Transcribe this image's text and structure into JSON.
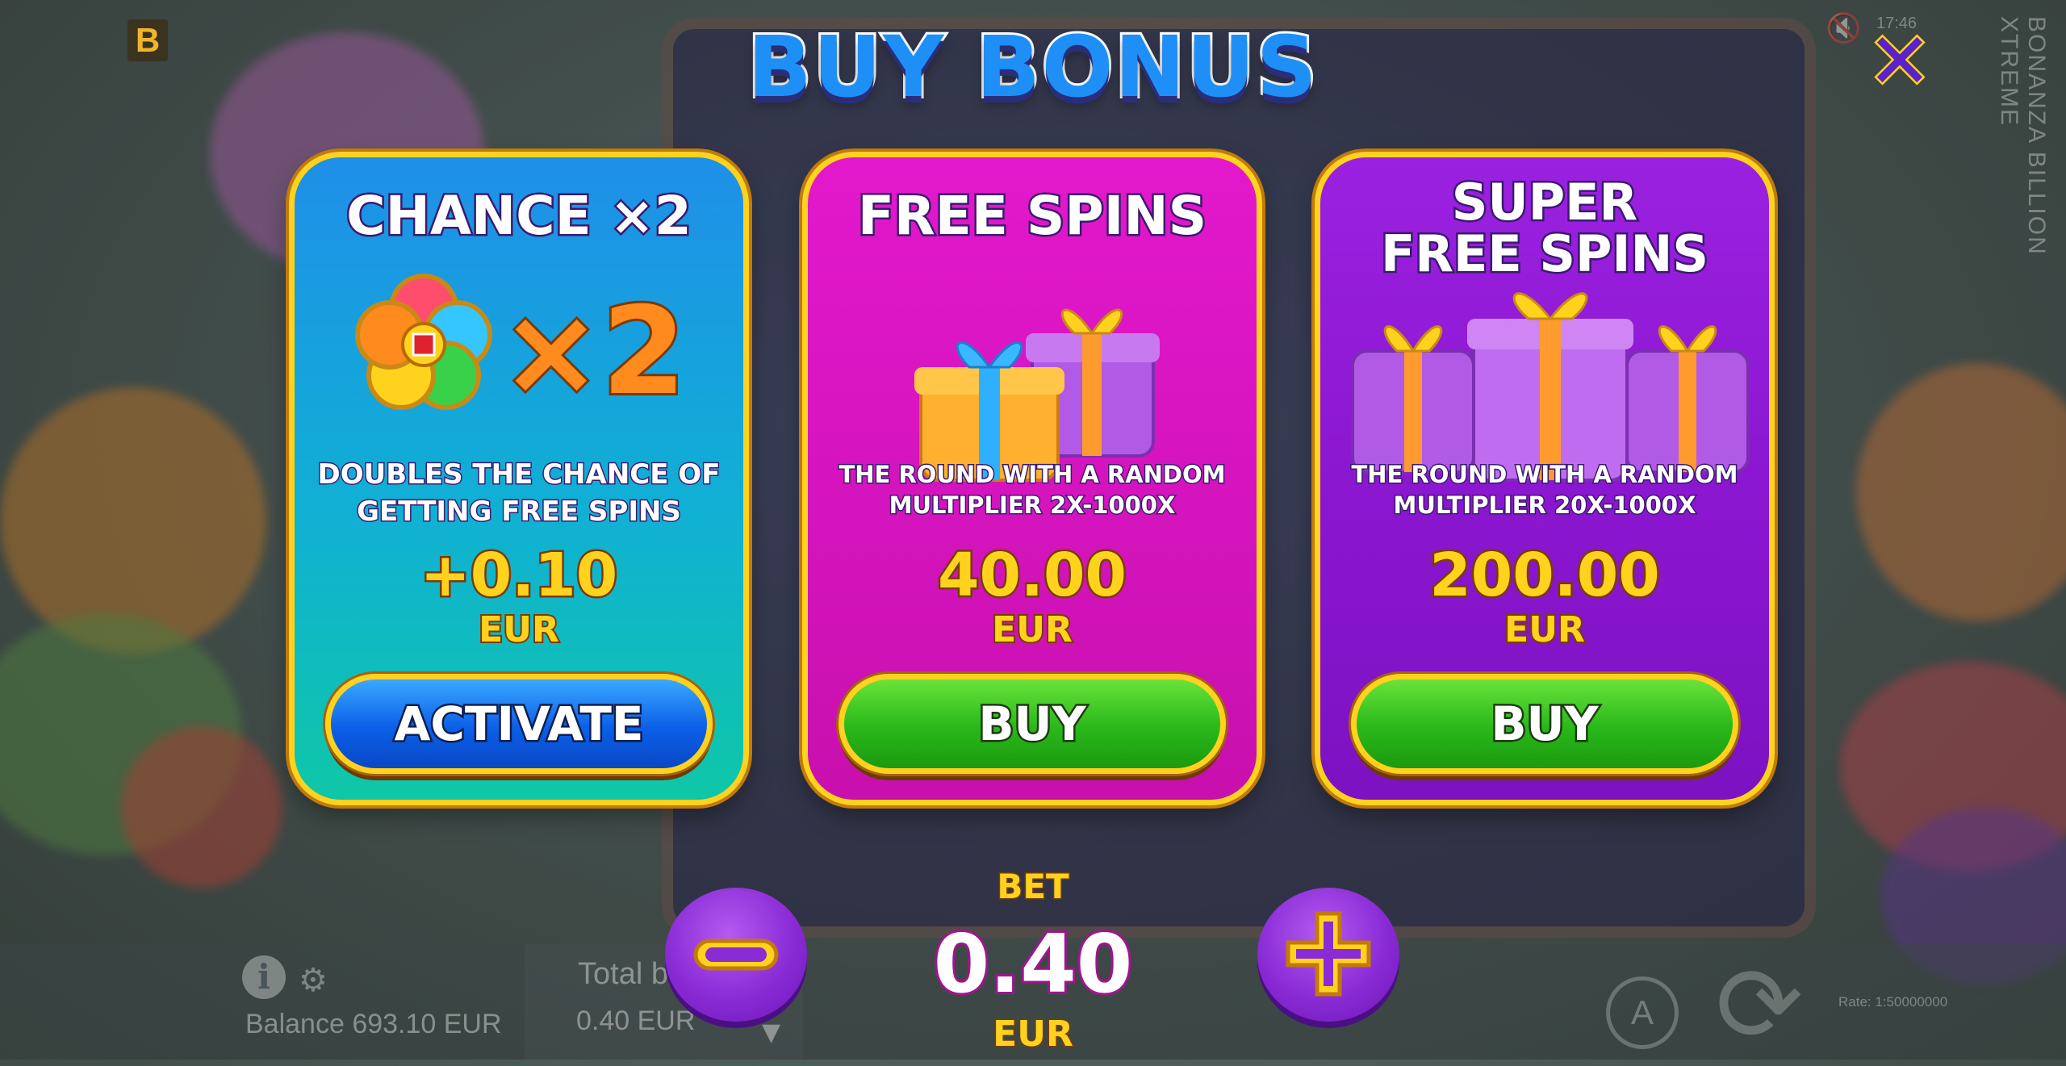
{
  "header": {
    "brand_letter": "B",
    "title": "BUY BONUS",
    "close_icon": "close-icon"
  },
  "side": {
    "vertical_text": "BONANZA BILLION XTREME",
    "clock": "17:46"
  },
  "cards": [
    {
      "title": "CHANCE ×2",
      "description": "DOUBLES THE CHANCE OF GETTING FREE SPINS",
      "price": "+0.10",
      "currency": "EUR",
      "button_label": "ACTIVATE",
      "color": "#1f8fe8"
    },
    {
      "title": "FREE SPINS",
      "description": "THE ROUND WITH A RANDOM MULTIPLIER 2X-1000X",
      "price": "40.00",
      "currency": "EUR",
      "button_label": "BUY",
      "color": "#e318cc"
    },
    {
      "title_line1": "SUPER",
      "title_line2": "FREE SPINS",
      "description": "THE ROUND WITH A RANDOM MULTIPLIER 20X-1000X",
      "price": "200.00",
      "currency": "EUR",
      "button_label": "BUY",
      "color": "#9b21e0"
    }
  ],
  "bet": {
    "label": "BET",
    "value": "0.40",
    "currency": "EUR"
  },
  "footer": {
    "balance": "Balance 693.10 EUR",
    "total_bet_label": "Total bet",
    "total_bet_value": "0.40 EUR",
    "rate": "Rate: 1:50000000"
  }
}
